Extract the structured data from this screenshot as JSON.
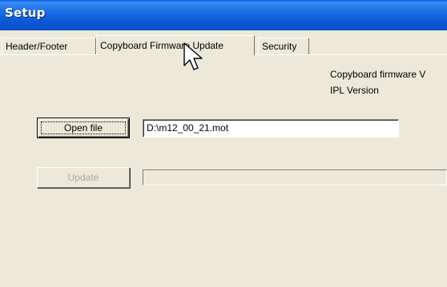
{
  "window": {
    "title": "Setup"
  },
  "tabs": [
    {
      "label": "Header/Footer",
      "active": false
    },
    {
      "label": "Copyboard Firmware Update",
      "active": true
    },
    {
      "label": "Security",
      "active": false
    }
  ],
  "firmware_panel": {
    "firmware_version_label": "Copyboard firmware V",
    "ipl_version_label": "IPL Version",
    "open_file_button": "Open file",
    "file_path_value": "D:\\m12_00_21.mot",
    "update_button": "Update",
    "update_progress_percent": 0
  },
  "colors": {
    "titlebar": "#0a58d6",
    "dialog_background": "#ece9d8",
    "disabled_text": "#aca899"
  },
  "cursor": {
    "icon": "arrow-cursor-icon"
  }
}
